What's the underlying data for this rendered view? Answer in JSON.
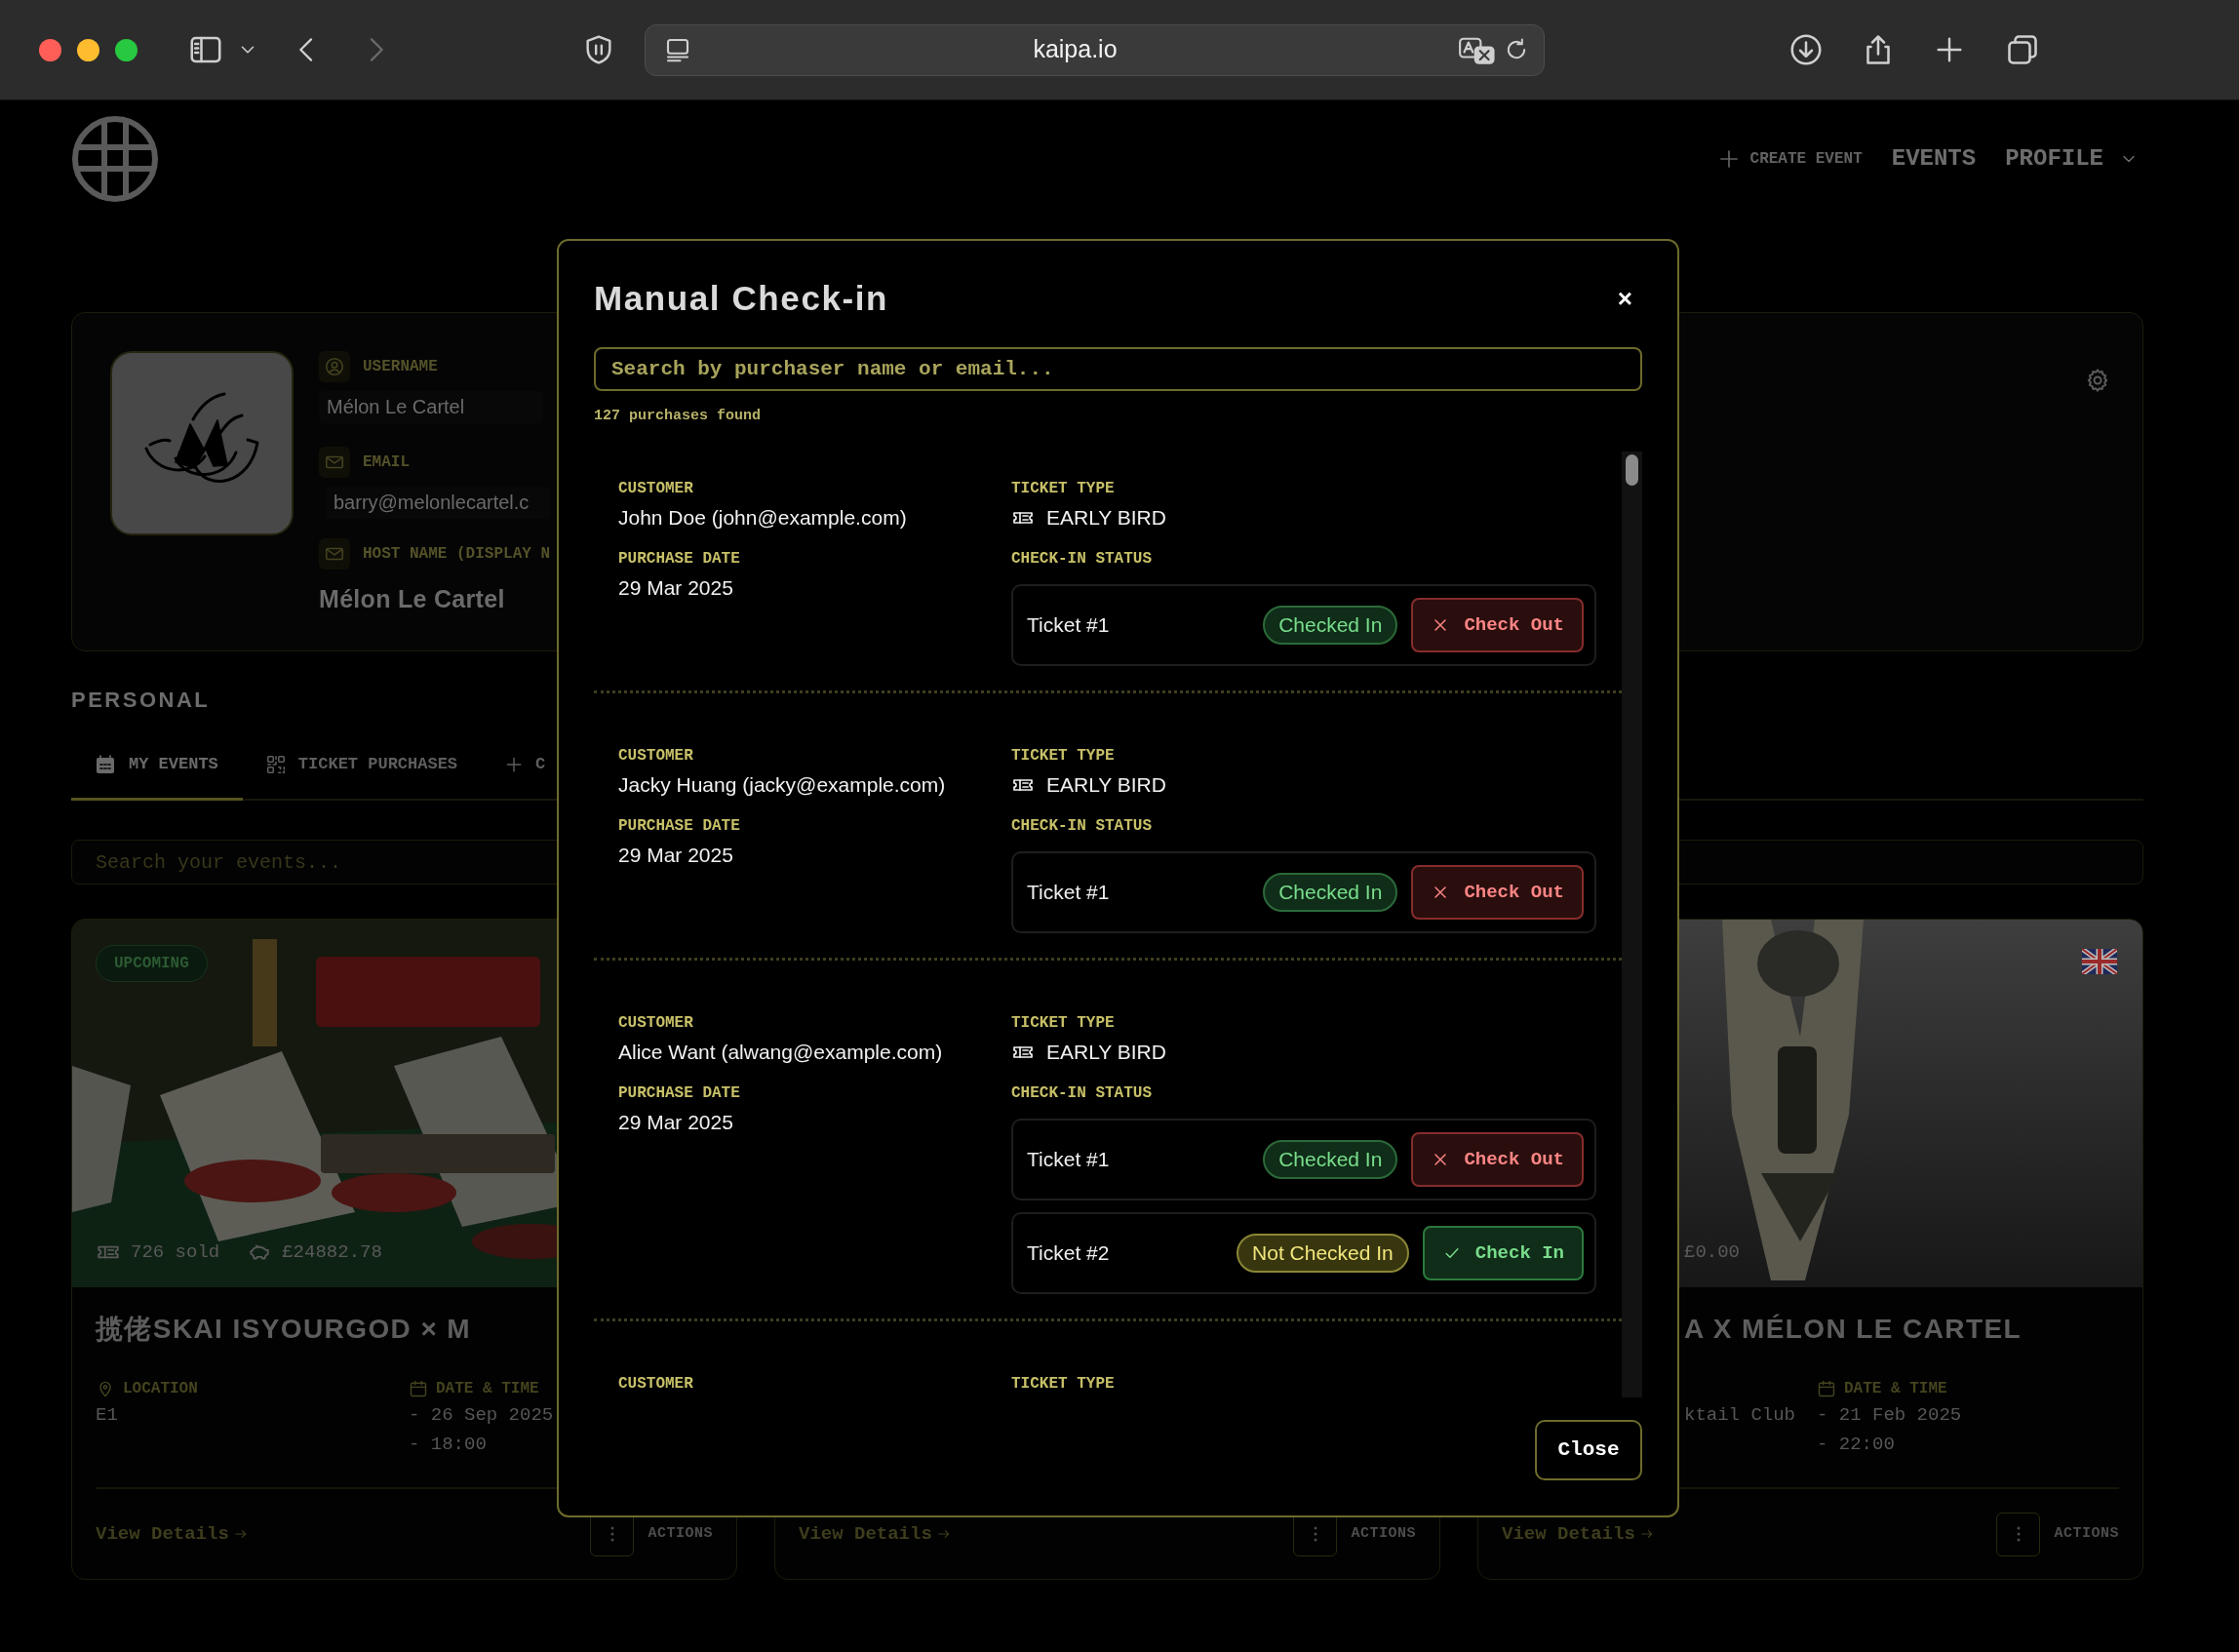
{
  "browser": {
    "url": "kaipa.io"
  },
  "header": {
    "nav": [
      {
        "kind": "create",
        "label": "CREATE EVENT"
      },
      {
        "kind": "link",
        "label": "EVENTS"
      },
      {
        "kind": "menu",
        "label": "PROFILE"
      }
    ]
  },
  "profile": {
    "fields": [
      {
        "kind": "user",
        "label": "USERNAME",
        "value": "Mélon Le Cartel"
      },
      {
        "kind": "email",
        "label": "EMAIL",
        "value": "barry@melonlecartel.c"
      },
      {
        "kind": "host",
        "label": "HOST NAME (DISPLAY N",
        "value": "Mélon Le Cartel"
      }
    ]
  },
  "section_title": "PERSONAL",
  "tabs": [
    {
      "kind": "events",
      "label": "MY EVENTS",
      "selected": true
    },
    {
      "kind": "purchases",
      "label": "TICKET PURCHASES",
      "selected": false
    },
    {
      "kind": "create",
      "label": "C",
      "selected": false
    }
  ],
  "search": {
    "placeholder": "Search your events..."
  },
  "events": [
    {
      "kind": "full",
      "status": "UPCOMING",
      "stats": [
        {
          "kind": "sold",
          "text": "726 sold"
        },
        {
          "kind": "revenue",
          "text": "£24882.78"
        }
      ],
      "title": "揽佬SKAI ISYOURGOD × M",
      "location_label": "LOCATION",
      "location": "E1",
      "date_label": "DATE & TIME",
      "dates": [
        "- 26 Sep 2025",
        "- 18:00"
      ],
      "link": "View Details",
      "actions": "ACTIONS"
    },
    {
      "kind": "hidden",
      "link": "View Details",
      "actions": "ACTIONS"
    },
    {
      "kind": "cut",
      "stats": [
        {
          "kind": "revenue",
          "text": "£0.00"
        }
      ],
      "title": "A X MÉLON LE CARTEL",
      "location": "ktail Club",
      "date_label": "DATE & TIME",
      "dates": [
        "- 21 Feb 2025",
        "- 22:00"
      ],
      "link": "View Details",
      "actions": "ACTIONS"
    }
  ],
  "modal": {
    "title": "Manual Check-in",
    "close": "×",
    "search": {
      "placeholder": "Search by purchaser name or email..."
    },
    "count": "127 purchases found",
    "purchases": [
      {
        "customer_label": "CUSTOMER",
        "customer": "John Doe (john@example.com)",
        "date_label": "PURCHASE DATE",
        "date": "29 Mar 2025",
        "type_label": "TICKET TYPE",
        "ticket_type": "EARLY BIRD",
        "status_label": "CHECK-IN STATUS",
        "tickets": [
          {
            "name": "Ticket #1",
            "checked_in": true,
            "status": "Checked In",
            "action": "Check Out"
          }
        ]
      },
      {
        "customer_label": "CUSTOMER",
        "customer": "Jacky Huang (jacky@example.com)",
        "date_label": "PURCHASE DATE",
        "date": "29 Mar 2025",
        "type_label": "TICKET TYPE",
        "ticket_type": "EARLY BIRD",
        "status_label": "CHECK-IN STATUS",
        "tickets": [
          {
            "name": "Ticket #1",
            "checked_in": true,
            "status": "Checked In",
            "action": "Check Out"
          }
        ]
      },
      {
        "customer_label": "CUSTOMER",
        "customer": "Alice Want (alwang@example.com)",
        "date_label": "PURCHASE DATE",
        "date": "29 Mar 2025",
        "type_label": "TICKET TYPE",
        "ticket_type": "EARLY BIRD",
        "status_label": "CHECK-IN STATUS",
        "tickets": [
          {
            "name": "Ticket #1",
            "checked_in": true,
            "status": "Checked In",
            "action": "Check Out"
          },
          {
            "name": "Ticket #2",
            "checked_in": false,
            "status": "Not Checked In",
            "action": "Check In"
          }
        ]
      },
      {
        "customer_label": "CUSTOMER",
        "type_label": "TICKET TYPE"
      }
    ],
    "footer_button": "Close"
  }
}
